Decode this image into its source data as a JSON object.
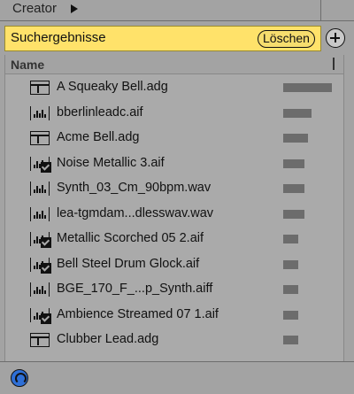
{
  "topbar": {
    "creator_label": "Creator"
  },
  "search": {
    "label": "Suchergebnisse",
    "clear_label": "Löschen"
  },
  "list": {
    "column_name": "Name",
    "items": [
      {
        "name": "A Squeaky Bell.adg",
        "type": "preset-icon",
        "bar": 0.88
      },
      {
        "name": "bberlinleadc.aif",
        "type": "audio-icon",
        "bar": 0.52
      },
      {
        "name": "Acme Bell.adg",
        "type": "preset-icon",
        "bar": 0.45
      },
      {
        "name": "Noise Metallic 3.aif",
        "type": "audio-checked-icon",
        "bar": 0.38
      },
      {
        "name": "Synth_03_Cm_90bpm.wav",
        "type": "audio-icon",
        "bar": 0.38
      },
      {
        "name": "lea-tgmdam...dlesswav.wav",
        "type": "audio-icon",
        "bar": 0.38
      },
      {
        "name": "Metallic Scorched 05 2.aif",
        "type": "audio-checked-icon",
        "bar": 0.28
      },
      {
        "name": "Bell Steel Drum Glock.aif",
        "type": "audio-checked-icon",
        "bar": 0.28
      },
      {
        "name": "BGE_170_F_...p_Synth.aiff",
        "type": "audio-icon",
        "bar": 0.28
      },
      {
        "name": "Ambience Streamed 07 1.aif",
        "type": "audio-checked-icon",
        "bar": 0.28
      },
      {
        "name": "Clubber Lead.adg",
        "type": "preset-icon",
        "bar": 0.28
      }
    ]
  },
  "colors": {
    "search_bg": "#ffe26a",
    "panel_bg": "#aaaaaa",
    "hotswap_blue": "#2e6fd6"
  }
}
